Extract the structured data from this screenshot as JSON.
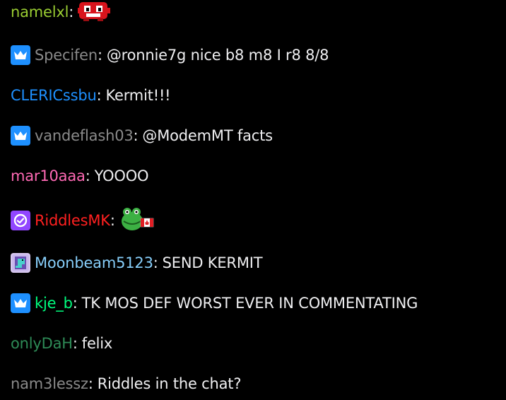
{
  "colors": {
    "background": "#000000",
    "text": "#efeff1",
    "prime_badge": "#1e90ff",
    "verified_badge": "#9146ff"
  },
  "messages": [
    {
      "user": "namelxl",
      "color": "#9acd32",
      "sep": ":",
      "text": "",
      "badge": null,
      "emote": "meat-boy-emote"
    },
    {
      "user": "Specifen",
      "color": "#8a8a8a",
      "sep": ":",
      "text": "@ronnie7g nice b8 m8 I r8 8/8",
      "badge": "prime-crown-icon"
    },
    {
      "user": "CLERICssbu",
      "color": "#1e90ff",
      "sep": ":",
      "text": "Kermit!!!",
      "badge": null
    },
    {
      "user": "vandeflash03",
      "color": "#8a8a8a",
      "sep": ":",
      "text": "@ModemMT facts",
      "badge": "prime-crown-icon"
    },
    {
      "user": "mar10aaa",
      "color": "#ff69b4",
      "sep": ":",
      "text": "YOOOO",
      "badge": null
    },
    {
      "user": "RiddlesMK",
      "color": "#ff0000",
      "sep": ":",
      "text": "",
      "badge": "verified-check-icon",
      "emote": "kermit-canada-emote"
    },
    {
      "user": "Moonbeam5123",
      "color": "#87cefa",
      "sep": ":",
      "text": "SEND KERMIT",
      "badge": "pixel-dino-icon"
    },
    {
      "user": "kje_b",
      "color": "#00ff7f",
      "sep": ":",
      "text": "TK MOS DEF WORST EVER IN COMMENTATING",
      "badge": "prime-crown-icon"
    },
    {
      "user": "onlyDaH",
      "color": "#2e8b57",
      "sep": ":",
      "text": "felix",
      "badge": null
    },
    {
      "user": "nam3lessz",
      "color": "#8a8a8a",
      "sep": ":",
      "text": "Riddles in the chat?",
      "badge": null
    }
  ]
}
